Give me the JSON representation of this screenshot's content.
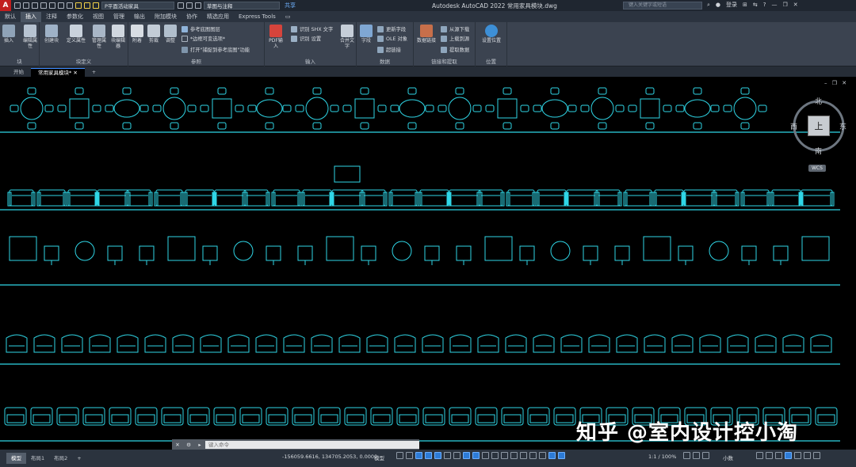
{
  "titlebar": {
    "app_logo": "A",
    "workspace": "P平面活动家具",
    "annotation_scale": "草图与注释",
    "share": "共享",
    "title": "Autodesk AutoCAD 2022    常用家具模块.dwg",
    "search_placeholder": "键入关键字或短语",
    "login": "登录"
  },
  "menus": [
    "默认",
    "插入",
    "注释",
    "参数化",
    "视图",
    "管理",
    "输出",
    "附加模块",
    "协作",
    "精选应用",
    "Express Tools"
  ],
  "active_menu": "插入",
  "ribbon": {
    "block_panel": {
      "label": "块",
      "insert": "插入",
      "edit_attr": "编辑属性"
    },
    "block_def_panel": {
      "label": "块定义",
      "create": "创建块",
      "define_attr": "定义属性",
      "manage_attr": "管理属性",
      "block_editor": "块编辑器"
    },
    "reference_panel": {
      "label": "参照",
      "attach": "附着",
      "clip": "剪裁",
      "adjust": "调整",
      "underlay_layers": "参考底图图层",
      "frames": "*边框可变选项*",
      "snap": "打开\"捕捉到参考底图\"功能"
    },
    "import_panel": {
      "label": "输入",
      "pdf_import": "PDF输入",
      "recognize_shx": "识别 SHX 文字",
      "recognize_settings": "识别 设置",
      "combine_text": "合并文字"
    },
    "data_panel": {
      "label": "数据",
      "field": "字段",
      "update_fields": "更新字段",
      "ole": "OLE 对象",
      "hyperlink": "超链接"
    },
    "link_panel": {
      "label": "链接和提取",
      "data_link": "数据链接",
      "download_source": "从源下载",
      "upload_source": "上载到源",
      "extract_data": "提取数据"
    },
    "location_panel": {
      "label": "位置",
      "set_location": "设置位置"
    }
  },
  "doc_tabs": [
    "开始",
    "常用家具模块*"
  ],
  "active_tab": "常用家具模块*",
  "viewcube": {
    "north": "北",
    "south": "南",
    "east": "东",
    "west": "西",
    "face": "上",
    "wcs": "WCS"
  },
  "watermark": "知乎 @室内设计控小淘",
  "command": {
    "placeholder": "键入命令"
  },
  "layout_tabs": [
    "模型",
    "布局1",
    "布局2"
  ],
  "status": {
    "coordinates": "-156059.6616, 134705.2053, 0.0000",
    "model": "模型",
    "scale": "1:1 / 100%",
    "units": "小数"
  },
  "colors": {
    "accent": "#2d7bd6",
    "drawing_cyan": "#2fd6e6",
    "ribbon_bg": "#3b4350"
  }
}
